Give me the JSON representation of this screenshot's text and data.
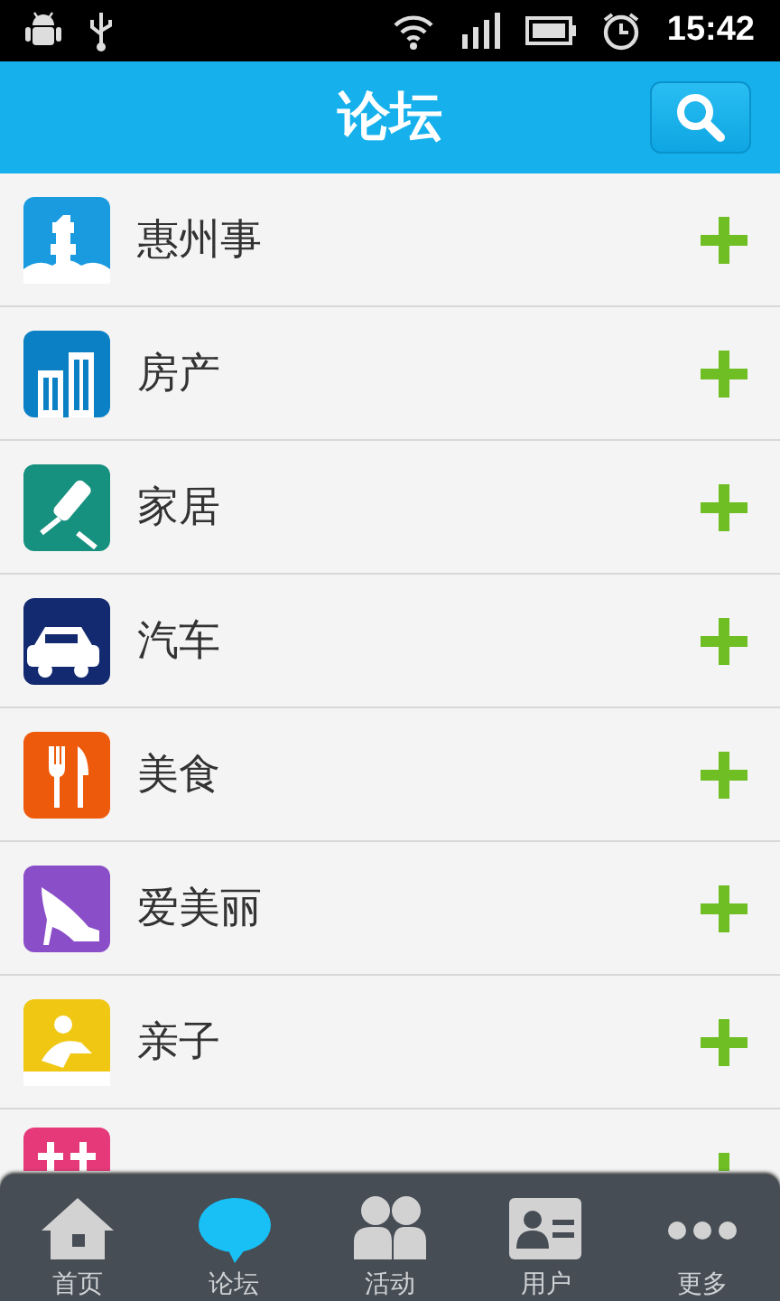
{
  "status_bar": {
    "time": "15:42"
  },
  "header": {
    "title": "论坛"
  },
  "forums": [
    {
      "kind": "row",
      "name": "惠州事",
      "color": "#1a9be0"
    },
    {
      "kind": "row",
      "name": "房产",
      "color": "#0b80c4"
    },
    {
      "kind": "row",
      "name": "家居",
      "color": "#16907f"
    },
    {
      "kind": "row",
      "name": "汽车",
      "color": "#142a70"
    },
    {
      "kind": "row",
      "name": "美食",
      "color": "#ee5a0c"
    },
    {
      "kind": "row",
      "name": "爱美丽",
      "color": "#8a4fc8"
    },
    {
      "kind": "row",
      "name": "亲子",
      "color": "#f0c814"
    },
    {
      "kind": "partial",
      "color": "#e6397a"
    }
  ],
  "tab_bar": [
    {
      "label": "首页",
      "selected": false
    },
    {
      "label": "论坛",
      "selected": true
    },
    {
      "label": "活动",
      "selected": false
    },
    {
      "label": "用户",
      "selected": false
    },
    {
      "label": "更多",
      "selected": false
    }
  ]
}
